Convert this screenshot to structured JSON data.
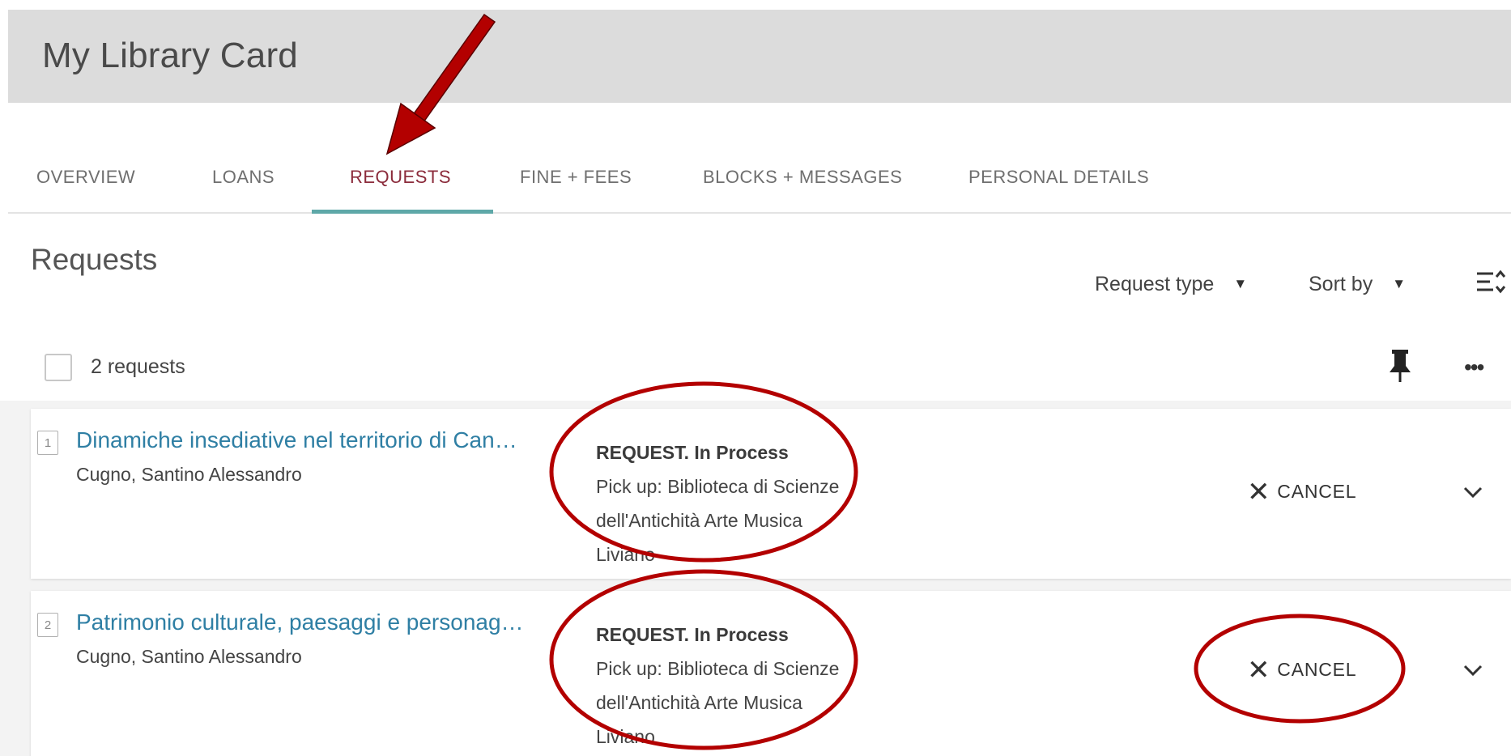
{
  "header": {
    "title": "My Library Card"
  },
  "tabs": [
    {
      "label": "OVERVIEW"
    },
    {
      "label": "LOANS"
    },
    {
      "label": "REQUESTS",
      "active": true
    },
    {
      "label": "FINE + FEES"
    },
    {
      "label": "BLOCKS + MESSAGES"
    },
    {
      "label": "PERSONAL DETAILS"
    }
  ],
  "section": {
    "title": "Requests",
    "filters": {
      "request_type": "Request type",
      "sort_by": "Sort by"
    },
    "count_text": "2 requests"
  },
  "requests": [
    {
      "number": "1",
      "title": "Dinamiche insediative nel territorio di Can…",
      "author": "Cugno, Santino Alessandro",
      "status": "REQUEST. In Process",
      "pickup_line1": "Pick up: Biblioteca di Scienze",
      "pickup_line2": "dell'Antichità Arte Musica",
      "pickup_line3": "Liviano",
      "cancel_label": "CANCEL"
    },
    {
      "number": "2",
      "title": "Patrimonio culturale, paesaggi e personag…",
      "author": "Cugno, Santino Alessandro",
      "status": "REQUEST. In Process",
      "pickup_line1": "Pick up: Biblioteca di Scienze",
      "pickup_line2": "dell'Antichità Arte Musica",
      "pickup_line3": "Liviano",
      "cancel_label": "CANCEL"
    }
  ],
  "colors": {
    "active_tab": "#8b2b3b",
    "tab_indicator": "#5ea8a8",
    "link": "#2f7fa4",
    "annotation": "#b30000"
  },
  "icons": {
    "list_options": "list-options-icon",
    "pin": "pin-icon",
    "more": "more-icon",
    "cancel": "close-icon",
    "expand": "chevron-down-icon",
    "annotation_arrow": "arrow-icon"
  }
}
